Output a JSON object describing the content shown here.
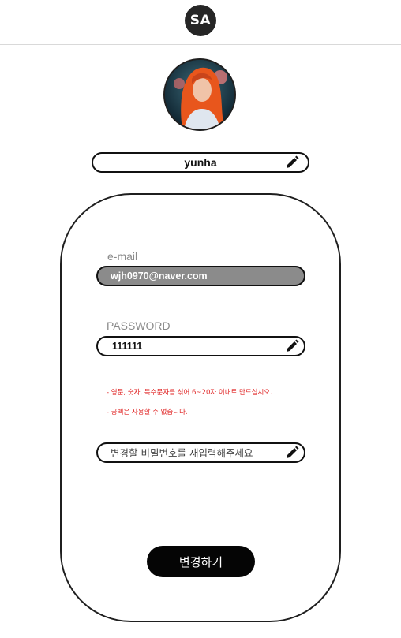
{
  "header": {
    "logo_text": "SA"
  },
  "profile": {
    "avatar_icon": "user-avatar",
    "nickname": "yunha",
    "edit_icon": "pencil-icon"
  },
  "form": {
    "email": {
      "label": "e-mail",
      "value": "wjh0970@naver.com"
    },
    "password": {
      "label": "PASSWORD",
      "value": "111111"
    },
    "notices": [
      "- 영문, 숫자, 특수문자를 섞어 6~20자 이내로 만드십시오.",
      "- 공백은 사용할 수 없습니다."
    ],
    "confirm_password": {
      "placeholder": "변경할 비밀번호를 재입력해주세요"
    },
    "submit_label": "변경하기"
  },
  "colors": {
    "accent": "#050505",
    "notice": "#e02424",
    "email_fill": "#8b8b8b"
  }
}
